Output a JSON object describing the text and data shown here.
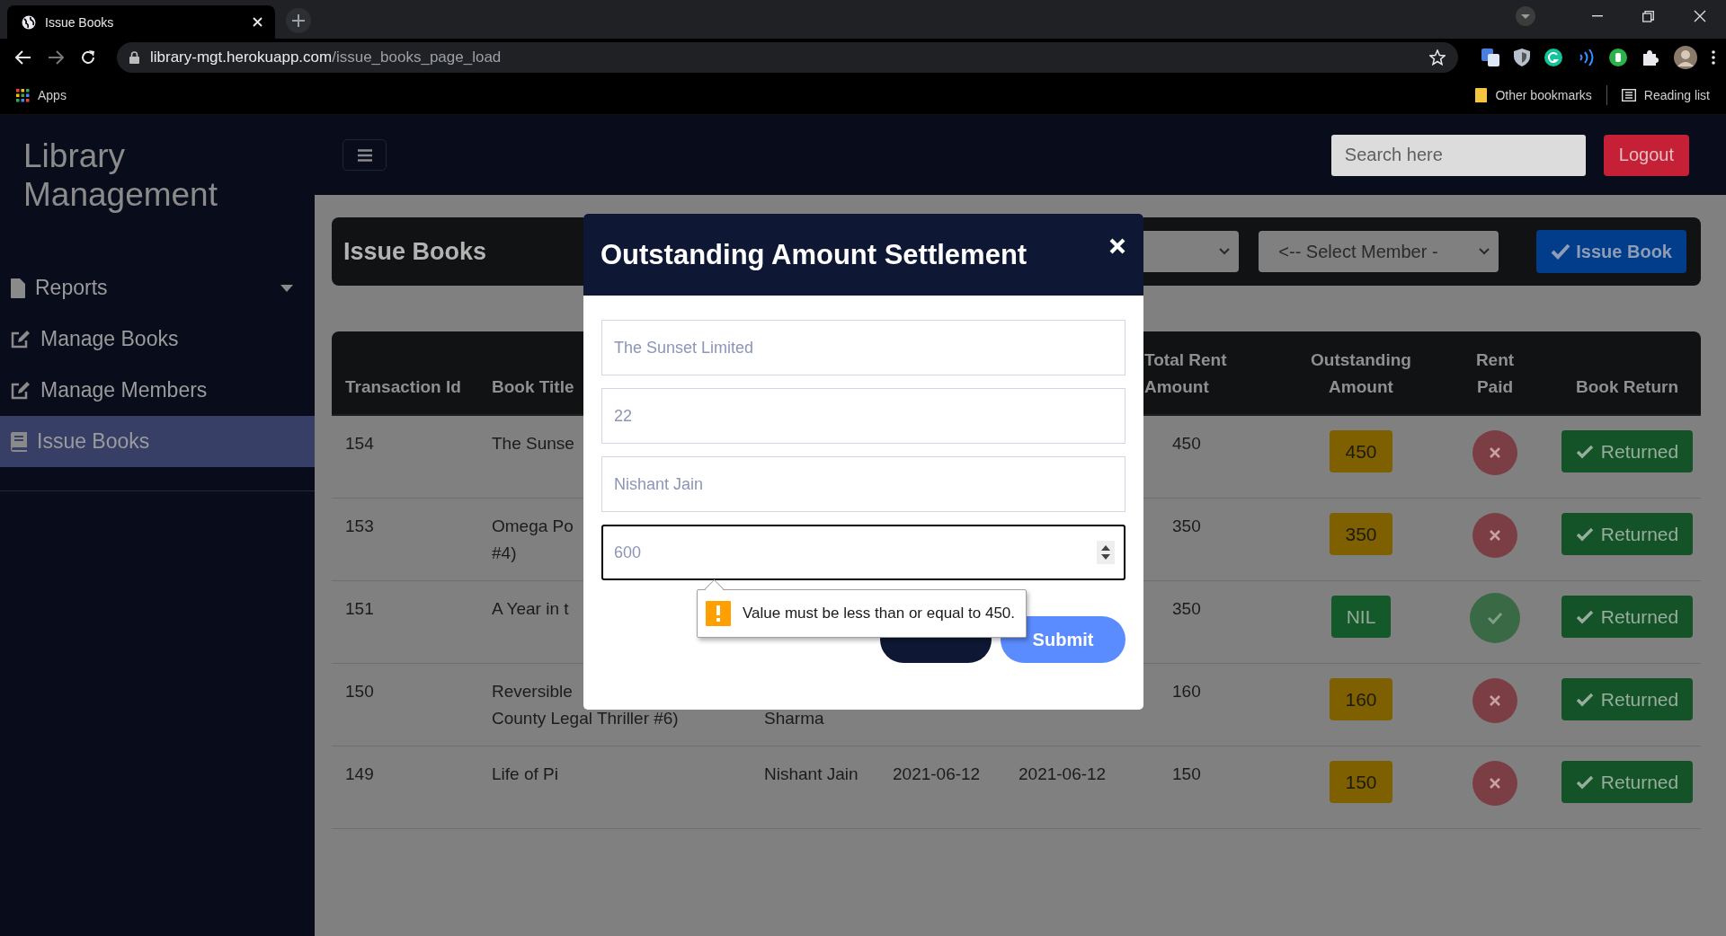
{
  "browser": {
    "tab_title": "Issue Books",
    "url_host": "library-mgt.herokuapp.com",
    "url_path": "/issue_books_page_load",
    "bookmarks": [
      {
        "label": "Apps"
      },
      {
        "label": "Other bookmarks"
      },
      {
        "label": "Reading list"
      }
    ]
  },
  "sidebar": {
    "title": "Library Management",
    "items": [
      {
        "label": "Reports",
        "kind": "dropdown",
        "selected": false
      },
      {
        "label": "Manage Books",
        "kind": "edit",
        "selected": false
      },
      {
        "label": "Manage Members",
        "kind": "edit",
        "selected": false
      },
      {
        "label": "Issue Books",
        "kind": "book",
        "selected": true
      }
    ]
  },
  "topbar": {
    "search_placeholder": "Search here",
    "logout": "Logout"
  },
  "page": {
    "title": "Issue Books",
    "member_select": "<-- Select Member -",
    "issue_button": "Issue Book"
  },
  "table": {
    "columns": [
      "Transaction Id",
      "Book Title",
      "Total Rent Amount",
      "Outstanding Amount",
      "Rent Paid",
      "Book Return"
    ],
    "rows": [
      {
        "id": "154",
        "title": "The Sunse",
        "total": "450",
        "outstanding": "450",
        "color": "#7f6000",
        "rent_paid": false,
        "return_label": "Returned"
      },
      {
        "id": "153",
        "title": "Omega Po",
        "title_2": "#4)",
        "total": "350",
        "outstanding": "350",
        "color": "#7f6000",
        "rent_paid": false,
        "return_label": "Returned"
      },
      {
        "id": "151",
        "title": "A Year in t",
        "total": "350",
        "outstanding": "NIL",
        "color": "#14592a",
        "rent_paid": true,
        "return_label": "Returned"
      },
      {
        "id": "150",
        "title": "Reversible",
        "title_2": "County Legal Thriller #6)",
        "member": "Sharma",
        "member_continued": true,
        "total": "160",
        "outstanding": "160",
        "color": "#7f6000",
        "rent_paid": false,
        "return_label": "Returned"
      },
      {
        "id": "149",
        "title": "Life of Pi",
        "member": "Nishant Jain",
        "member_continued": false,
        "issue_date": "2021-06-12",
        "return_date": "2021-06-12",
        "total": "150",
        "outstanding": "150",
        "color": "#7f6000",
        "rent_paid": false,
        "return_label": "Returned"
      }
    ]
  },
  "modal": {
    "title": "Outstanding Amount Settlement",
    "fields": [
      {
        "value": "The Sunset Limited",
        "kind": "text",
        "focused": false
      },
      {
        "value": "22",
        "kind": "text",
        "focused": false
      },
      {
        "value": "Nishant Jain",
        "kind": "text",
        "focused": false
      },
      {
        "value": "600",
        "kind": "number",
        "focused": true
      }
    ],
    "validation_message": "Value must be less than or equal to 450.",
    "submit_button": "Submit"
  }
}
